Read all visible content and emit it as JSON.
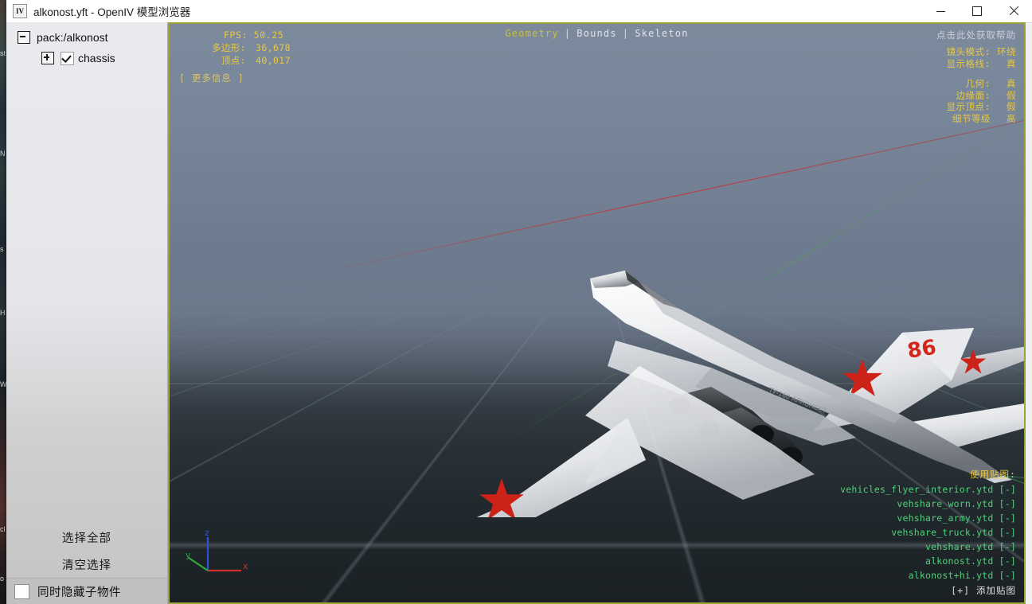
{
  "window": {
    "title": "alkonost.yft - OpenIV 模型浏览器",
    "icon": "openiv-app-icon",
    "controls": {
      "minimize": "minimize-button",
      "maximize": "maximize-button",
      "close": "close-button"
    }
  },
  "sidebar": {
    "tree": [
      {
        "label": "pack:/alkonost",
        "expander": "minus",
        "has_checkbox": false,
        "checked": false,
        "level": 0
      },
      {
        "label": "chassis",
        "expander": "plus",
        "has_checkbox": true,
        "checked": true,
        "level": 1
      }
    ],
    "actions": [
      {
        "label": "选择全部",
        "name": "select-all-button"
      },
      {
        "label": "清空选择",
        "name": "clear-selection-button"
      }
    ],
    "hide_children": {
      "label": "同时隐藏子物件",
      "checked": false
    }
  },
  "viewport": {
    "border_color": "#9aa33a",
    "stats": {
      "fps_label": "FPS:",
      "fps_value": "50.25",
      "polygons_label": "多边形:",
      "polygons_value": "36,678",
      "vertices_label": "顶点:",
      "vertices_value": "40,017",
      "more_info": "[ 更多信息 ]"
    },
    "tabs": [
      {
        "label": "Geometry",
        "active": true
      },
      {
        "label": "Bounds",
        "active": false
      },
      {
        "label": "Skeleton",
        "active": false
      }
    ],
    "tab_separator": "|",
    "help_hint": "点击此处获取帮助",
    "settings": {
      "camera_mode_label": "镜头模式:",
      "camera_mode_value": "环绕",
      "show_grid_label": "显示格线:",
      "show_grid_value": "真",
      "geometry_label": "几何:",
      "geometry_value": "真",
      "edge_faces_label": "边缘面:",
      "edge_faces_value": "假",
      "show_vertices_label": "显示顶点:",
      "show_vertices_value": "假",
      "lod_label": "细节等级",
      "lod_value": "高"
    },
    "textures": {
      "title": "使用贴图:",
      "items": [
        "vehicles_flyer_interior.ytd [-]",
        "vehshare_worn.ytd [-]",
        "vehshare_army.ytd [-]",
        "vehshare_truck.ytd [-]",
        "vehshare.ytd [-]",
        "alkonost.ytd [-]",
        "alkonost+hi.ytd [-]"
      ],
      "add_label": "[+] 添加贴图"
    },
    "gizmo": {
      "x_label": "x",
      "y_label": "y",
      "z_label": "z",
      "x_color": "#d03030",
      "y_color": "#2fa83f",
      "z_color": "#3050d8"
    },
    "model": {
      "tail_number": "86",
      "insignia": "red-star",
      "body_color": "#e9eaec",
      "insignia_color": "#cc2218"
    }
  },
  "background_windows": {
    "left_strip_text": [
      "st",
      "N",
      "s",
      "H",
      "W",
      "cl",
      "o"
    ],
    "right_strip_marks": 7
  }
}
